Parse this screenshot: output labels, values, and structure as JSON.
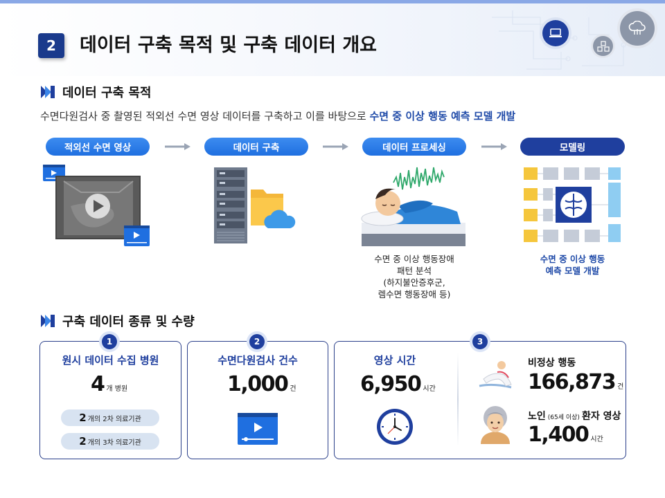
{
  "header": {
    "section_number": "2",
    "title": "데이터 구축 목적 및 구축 데이터 개요"
  },
  "purpose": {
    "heading": "데이터 구축 목적",
    "description_plain": "수면다원검사 중 촬영된 적외선 수면 영상 데이터를 구축하고 이를 바탕으로 ",
    "description_highlight": "수면 중 이상 행동 예측 모델 개발",
    "steps": [
      {
        "label": "적외선 수면 영상"
      },
      {
        "label": "데이터 구축"
      },
      {
        "label": "데이터 프로세싱"
      },
      {
        "label": "모델링"
      }
    ],
    "processing_caption": [
      "수면 중 이상 행동장애",
      "패턴 분석",
      "(하지불안증후군,",
      "렘수면 행동장애 등)"
    ],
    "modeling_caption": [
      "수면 중 이상 행동",
      "예측 모델 개발"
    ]
  },
  "data_types": {
    "heading": "구축 데이터 종류 및 수량",
    "cards": [
      {
        "badge": "1",
        "title": "원시 데이터 수집 병원",
        "value": "4",
        "unit": "개 병원",
        "chips": [
          {
            "num": "2",
            "text": "개의 2차 의료기관"
          },
          {
            "num": "2",
            "text": "개의 3차 의료기관"
          }
        ]
      },
      {
        "badge": "2",
        "title": "수면다원검사 건수",
        "value": "1,000",
        "unit": "건"
      },
      {
        "badge": "3",
        "title": "영상 시간",
        "value": "6,950",
        "unit": "시간",
        "abnormal_title": "비정상 행동",
        "abnormal_value": "166,873",
        "abnormal_unit": "건",
        "elderly_title_a": "노인",
        "elderly_title_small": "(65세 이상)",
        "elderly_title_b": "환자 영상",
        "elderly_value": "1,400",
        "elderly_unit": "시간"
      }
    ]
  },
  "colors": {
    "navy": "#1f3f9e",
    "blue": "#1f6fe0",
    "accent_text": "#1f4aa8"
  },
  "icons": [
    "laptop-icon",
    "cloud-network-icon",
    "cubes-icon",
    "play-icon",
    "server-icon",
    "folder-icon",
    "cloud-icon",
    "brain-icon",
    "clock-icon",
    "video-player-icon",
    "grandmother-icon",
    "sleepwalk-icon"
  ]
}
